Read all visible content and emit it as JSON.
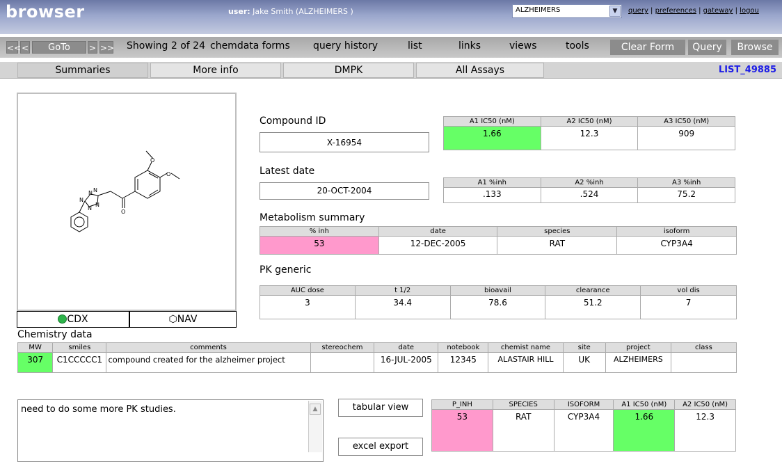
{
  "app": {
    "brand": "browser"
  },
  "user": {
    "label": "user:",
    "name": "Jake Smith (ALZHEIMERS )"
  },
  "project_select": {
    "value": "ALZHEIMERS"
  },
  "top_links": {
    "query": "query",
    "preferences": "preferences",
    "gateway": "gateway",
    "logout": "logou"
  },
  "navbar": {
    "first": "<<",
    "prev": "<",
    "goto": "GoTo",
    "next": ">",
    "last": ">>",
    "showing": "Showing 2 of 24",
    "menus": [
      "chemdata forms",
      "query history",
      "list",
      "links",
      "views",
      "tools"
    ],
    "clear_form": "Clear Form",
    "query": "Query",
    "browse": "Browse"
  },
  "tabs": [
    "Summaries",
    "More info",
    "DMPK",
    "All Assays"
  ],
  "list_id": "LIST_49885",
  "structure": {
    "cdx_label": "CDX",
    "nav_label": "NAV",
    "cdx_icon": "cdx-icon",
    "nav_icon": "hexagon-icon"
  },
  "compound": {
    "id_label": "Compound ID",
    "id_value": "X-16954",
    "date_label": "Latest date",
    "date_value": "20-OCT-2004"
  },
  "ic50": {
    "headers": [
      "A1 IC50 (nM)",
      "A2 IC50 (nM)",
      "A3 IC50 (nM)"
    ],
    "values": [
      "1.66",
      "12.3",
      "909"
    ]
  },
  "inh": {
    "headers": [
      "A1 %inh",
      "A2 %inh",
      "A3 %inh"
    ],
    "values": [
      ".133",
      ".524",
      "75.2"
    ]
  },
  "metabolism": {
    "title": "Metabolism summary",
    "headers": [
      "% inh",
      "date",
      "species",
      "isoform"
    ],
    "values": [
      "53",
      "12-DEC-2005",
      "RAT",
      "CYP3A4"
    ]
  },
  "pk": {
    "title": "PK generic",
    "headers": [
      "AUC dose",
      "t 1/2",
      "bioavail",
      "clearance",
      "vol dis"
    ],
    "values": [
      "3",
      "34.4",
      "78.6",
      "51.2",
      "7"
    ]
  },
  "chemistry": {
    "title": "Chemistry data",
    "headers": [
      "MW",
      "smiles",
      "comments",
      "stereochem",
      "date",
      "notebook",
      "chemist name",
      "site",
      "project",
      "class"
    ],
    "values": [
      "307",
      "C1CCCCC1",
      "compound created for the alzheimer project",
      "",
      "16-JUL-2005",
      "12345",
      "ALASTAIR HILL",
      "UK",
      "ALZHEIMERS",
      ""
    ]
  },
  "notes": {
    "text": "need to do some more PK studies."
  },
  "actions": {
    "tabular": "tabular view",
    "excel": "excel export"
  },
  "summary_table": {
    "headers": [
      "P_INH",
      "SPECIES",
      "ISOFORM",
      "A1 IC50 (nM)",
      "A2 IC50 (nM)"
    ],
    "values": [
      "53",
      "RAT",
      "CYP3A4",
      "1.66",
      "12.3"
    ]
  },
  "colors": {
    "good": "#66ff66",
    "flag": "#ff99cc",
    "header_bar": "#7c88b4",
    "link_blue": "#1e1ee6"
  }
}
